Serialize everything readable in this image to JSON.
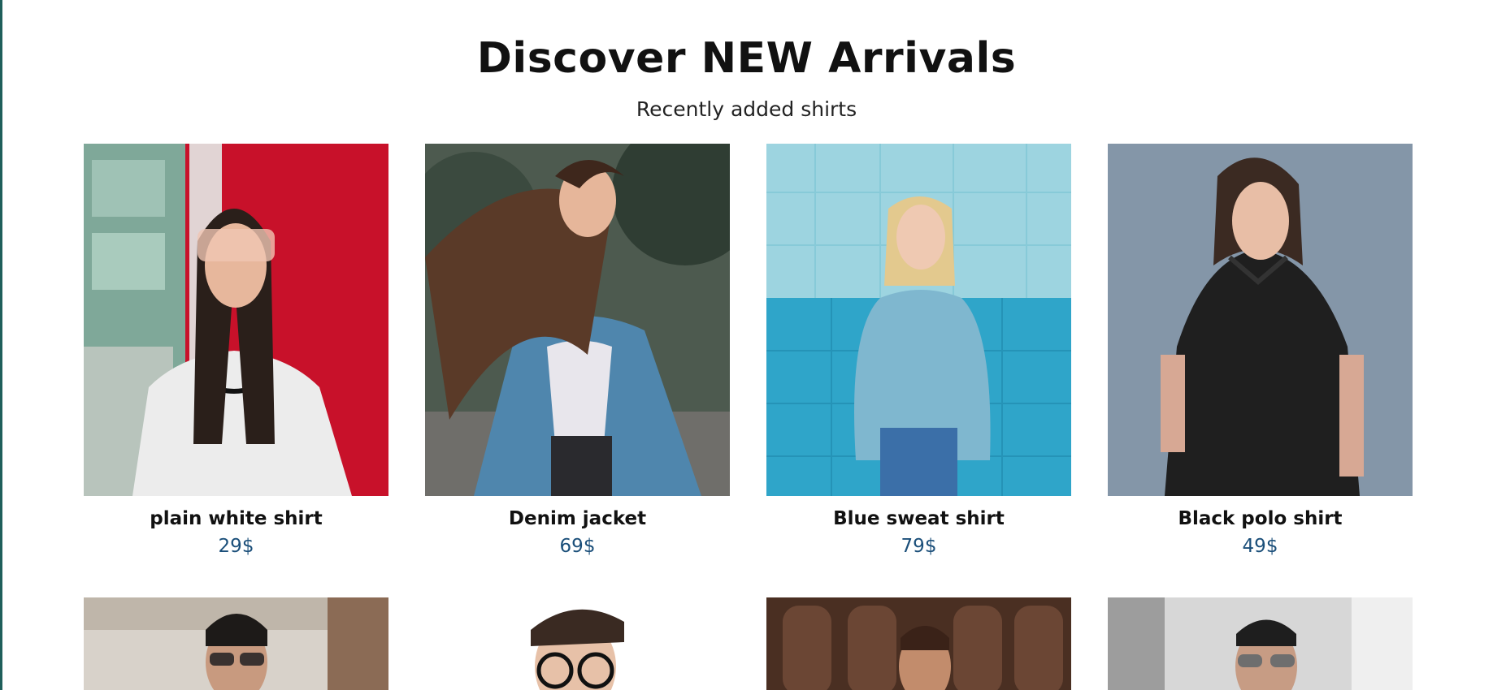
{
  "section": {
    "title": "Discover NEW Arrivals",
    "subtitle": "Recently added shirts"
  },
  "theme": {
    "price_color": "#1b4f7a",
    "edge_color": "#1f5f5b"
  },
  "products": [
    {
      "name": "plain white shirt",
      "price": "29$",
      "image": "woman-white-tee-photo"
    },
    {
      "name": "Denim jacket",
      "price": "69$",
      "image": "woman-denim-jacket-photo"
    },
    {
      "name": "Blue sweat shirt",
      "price": "79$",
      "image": "woman-blue-sweatshirt-photo"
    },
    {
      "name": "Black polo shirt",
      "price": "49$",
      "image": "woman-black-polo-photo"
    }
  ],
  "products_row2": [
    {
      "image": "man-sunglasses-photo"
    },
    {
      "image": "man-glasses-photo"
    },
    {
      "image": "man-wood-door-photo"
    },
    {
      "image": "man-aviators-photo"
    }
  ]
}
